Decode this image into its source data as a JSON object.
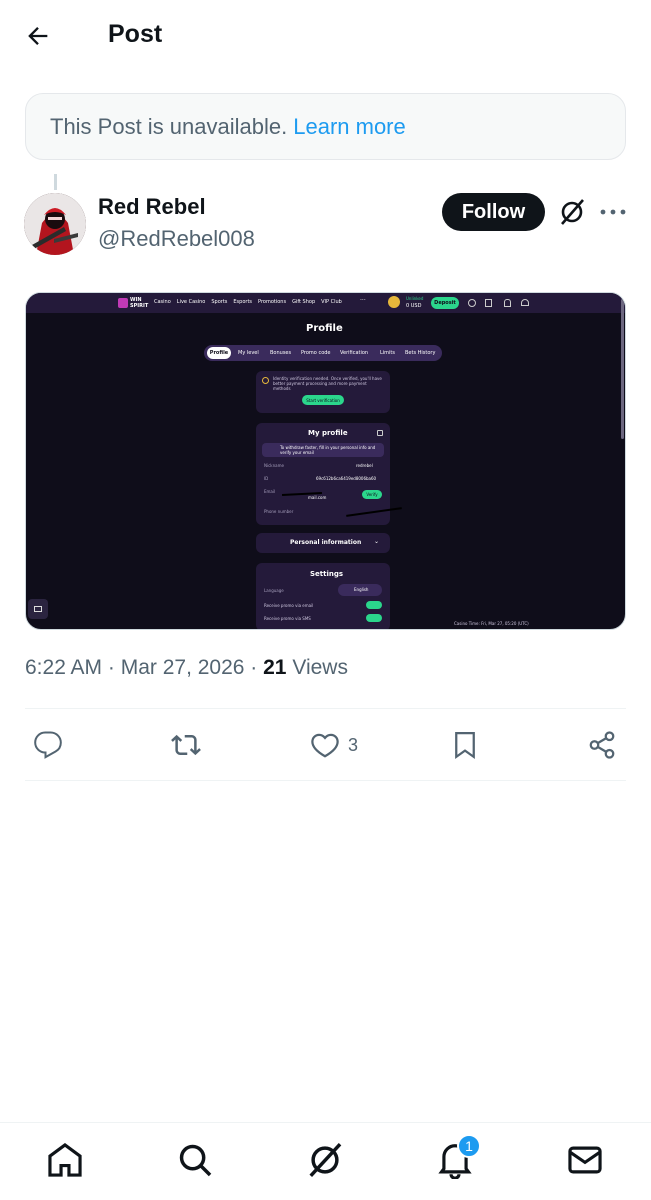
{
  "header": {
    "title": "Post"
  },
  "notice": {
    "text": "This Post is unavailable.",
    "link": "Learn more"
  },
  "author": {
    "name": "Red Rebel",
    "handle": "@RedRebel008",
    "follow_label": "Follow"
  },
  "post": {
    "time": "6:22 AM · Mar 27, 2026 · ",
    "views_count": "21",
    "views_label": " Views",
    "likes": "3"
  },
  "media": {
    "nav": [
      "Casino",
      "Live Casino",
      "Sports",
      "Esports",
      "Promotions",
      "Gift Shop",
      "VIP Club"
    ],
    "brand": "WIN SPIRIT",
    "balance_label": "Unlinked",
    "balance": "0 USD",
    "deposit": "Deposit",
    "page_title": "Profile",
    "tabs": [
      "Profile",
      "My level",
      "Bonuses",
      "Promo code",
      "Verification",
      "Limits",
      "Bets History"
    ],
    "verify_msg": "Identity verification needed. Once verified, you'll have better payment processing and more payment methods",
    "start_verification": "Start verification",
    "my_profile": "My profile",
    "withdraw_msg": "To withdraw faster, fill in your personal info and verify your email",
    "nickname_label": "Nickname",
    "nickname": "redrebel",
    "id_label": "ID",
    "id": "69c612b6ca6419ed8006ba60",
    "email_label": "Email",
    "email": "mail.com",
    "verify": "Verify",
    "phone_label": "Phone number",
    "personal_info": "Personal information",
    "settings": "Settings",
    "language_label": "Language",
    "language": "English",
    "promo_email": "Receive promo via email",
    "promo_sms": "Receive promo via SMS",
    "casino_time": "Casino Time: Fri, Mar 27, 05:20 (UTC)"
  },
  "notifications": {
    "badge": "1"
  },
  "colors": {
    "accent": "#1d9bf0",
    "brand_green": "#2bd68c",
    "screen_bg": "#0f0d1a",
    "card_bg": "#241a3a"
  }
}
